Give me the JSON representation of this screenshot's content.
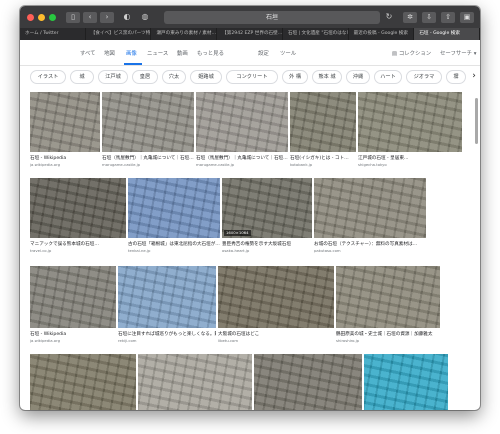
{
  "browser": {
    "url": "石垣",
    "tabs": [
      {
        "label": "ホーム / Twitter",
        "active": false
      },
      {
        "label": "【食イベ】ビス窯のパーツ特…",
        "active": false
      },
      {
        "label": "瀬戸の東みりの素材 / 素材…",
        "active": false
      },
      {
        "label": "【第2942 EZP 世界の石壁…",
        "active": false
      },
      {
        "label": "石垣 | 文化遺産 \"石垣のはなし\"",
        "active": false
      },
      {
        "label": "最近の投稿 - Google 検索",
        "active": false
      },
      {
        "label": "石垣 - Google 検索",
        "active": true
      }
    ]
  },
  "google": {
    "nav": [
      "すべて",
      "地図",
      "画像",
      "ニュース",
      "動画",
      "もっと見る",
      "設定",
      "ツール"
    ],
    "active_nav": "画像",
    "collection": "コレクション",
    "safesearch": "セーフサーチ ▾",
    "chips": [
      "イラスト",
      "城",
      "江戸城",
      "皇居",
      "穴太",
      "姫路城",
      "コンクリート",
      "外 構",
      "熊本 城",
      "沖縄",
      "ハート",
      "ジオラマ",
      "塀",
      "水前寺",
      "名古屋 城"
    ]
  },
  "results": [
    {
      "title": "石垣 - Wikipedia",
      "source": "ja.wikipedia.org"
    },
    {
      "title": "石垣（馬屋敷門）｜丸亀城について｜石垣…",
      "source": "marugame-castle.jp"
    },
    {
      "title": "石垣（馬屋敷門）｜丸亀城について｜石垣…",
      "source": "marugame-castle.jp"
    },
    {
      "title": "石垣(イシガキ)とは - コト…",
      "source": "kotobank.jp"
    },
    {
      "title": "江戸城の石垣 - 皇居東…",
      "source": "shigecha.tokyo"
    },
    {
      "title": "マニアックで誤る熊本城の石垣…",
      "source": "travel.co.jp"
    },
    {
      "title": "古の石垣「箱根城」は東北屈指の大石垣が…",
      "source": "tenkai.ne.jp"
    },
    {
      "title": "豊臣秀吉の権勢を示す大坂城石垣",
      "source": "osaka-heart.jp"
    },
    {
      "title": "お城の石垣（テクスチャー）：無料の写真素材は…",
      "source": "pakutaso.com"
    },
    {
      "title": "石垣 - Wikipedia",
      "source": "ja.wikipedia.org"
    },
    {
      "title": "石垣に注目すれば城巡りがもっと楽しくなる。難攻…",
      "source": "rekiji.com"
    },
    {
      "title": "大阪城の石垣はどこ",
      "source": "libetu.com"
    },
    {
      "title": "鶴田原美の城・史士城｜石垣の資源｜加藤雅太",
      "source": "shiroshiro.jp"
    },
    {
      "title": "",
      "source": ""
    },
    {
      "title": "",
      "source": ""
    },
    {
      "title": "",
      "source": ""
    },
    {
      "title": "",
      "source": ""
    }
  ],
  "badges": {
    "dimension": "1600×1064"
  }
}
